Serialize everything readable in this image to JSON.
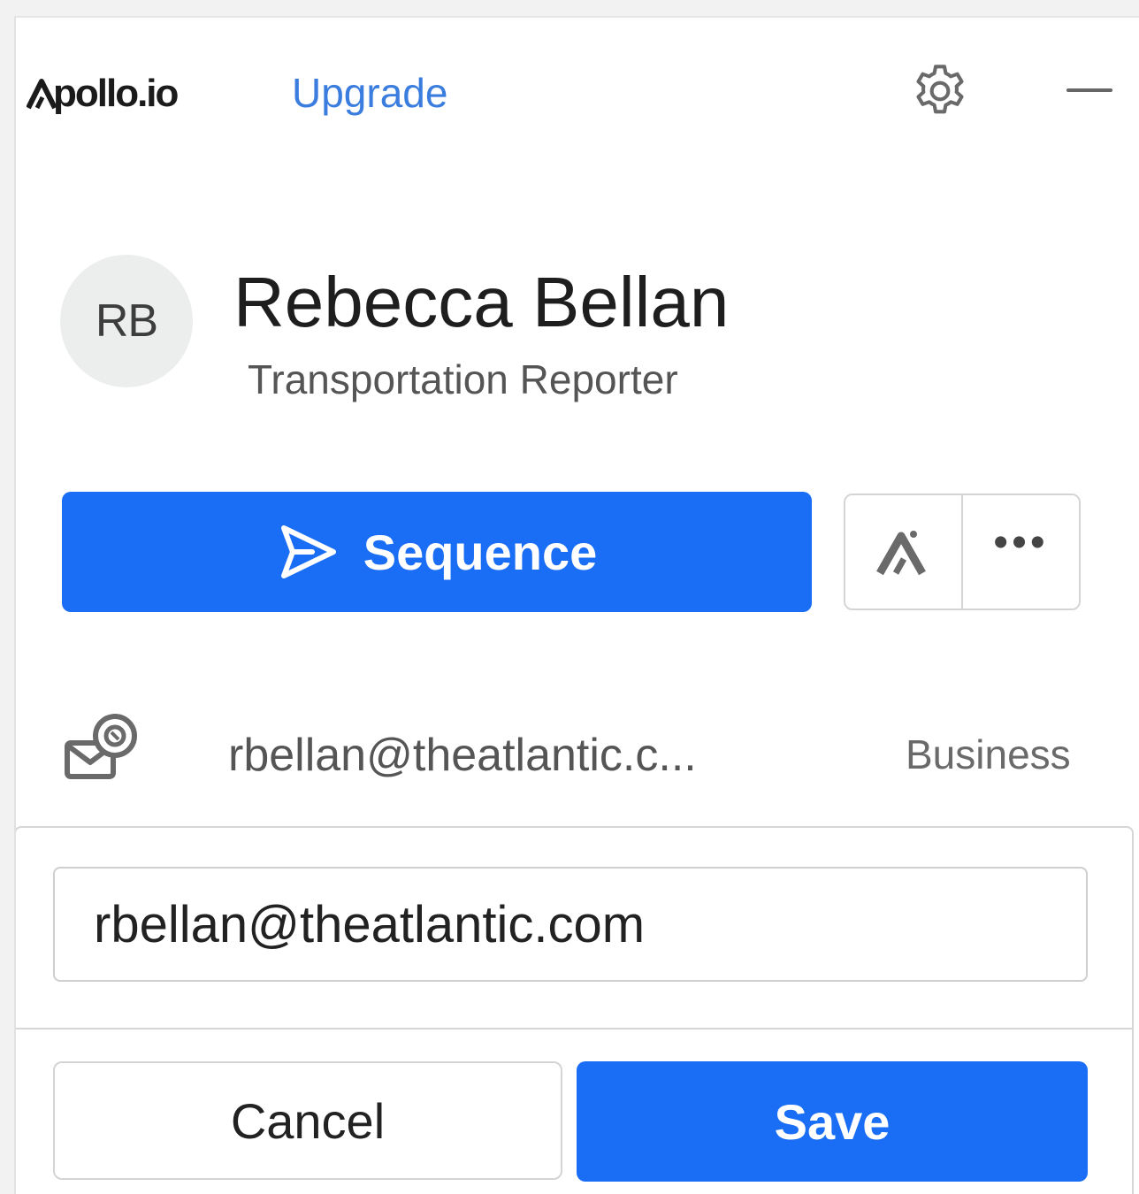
{
  "header": {
    "logo_text": "pollo.io",
    "upgrade_label": "Upgrade"
  },
  "profile": {
    "initials": "RB",
    "name": "Rebecca Bellan",
    "title": "Transportation Reporter"
  },
  "actions": {
    "sequence_label": "Sequence",
    "more_label": "•••"
  },
  "email_row": {
    "email_display": "rbellan@theatlantic.c...",
    "email_type": "Business"
  },
  "edit": {
    "email_value": "rbellan@theatlantic.com",
    "cancel_label": "Cancel",
    "save_label": "Save"
  },
  "colors": {
    "primary": "#1a6ef5",
    "link": "#3a7ddf",
    "text_dark": "#1e1e1e",
    "text_muted": "#555555"
  },
  "icons": {
    "settings": "gear-icon",
    "minimize": "minimize-icon",
    "sequence": "send-icon",
    "apollo": "apollo-logo-icon",
    "more": "more-horizontal-icon",
    "email": "email-verified-icon"
  }
}
